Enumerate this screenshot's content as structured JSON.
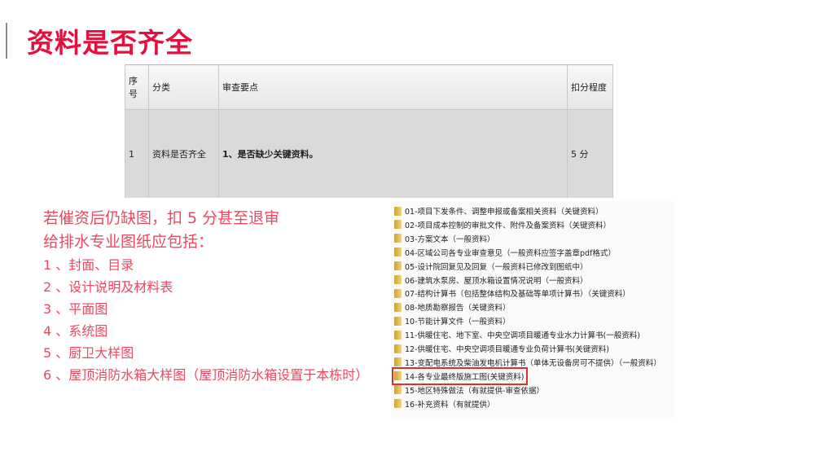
{
  "title": "资料是否齐全",
  "table": {
    "headers": [
      "序号",
      "分类",
      "审查要点",
      "扣分程度"
    ],
    "rows": [
      {
        "no": "1",
        "category": "资料是否齐全",
        "point": "1、是否缺少关键资料。",
        "deduction": "5 分"
      }
    ]
  },
  "notes": [
    "若催资后仍缺图，扣 5 分甚至退审",
    "给排水专业图纸应包括：",
    "1 、封面、目录",
    "2 、设计说明及材料表",
    "3 、平面图",
    "4 、系统图",
    "5 、厨卫大样图",
    "6 、屋顶消防水箱大样图（屋顶消防水箱设置于本栋时）"
  ],
  "files": [
    "01-项目下发条件、调整申报或备案相关资料（关键资料）",
    "02-项目成本控制的审批文件、附件及备案资料（关键资料）",
    "03-方案文本（一般资料）",
    "04-区域公司各专业审查意见（一般资料应签字盖章pdf格式）",
    "05-设计院回复见及回复（一般资料已修改到图纸中）",
    "06-建筑水泵房、屋顶水箱设置情况说明（一般资料）",
    "07-结构计算书（包括整体结构及基础等单项计算书）（关键资料）",
    "08-地质勘察报告（关键资料）",
    "10-节能计算文件（一般资料）",
    "11-供暖住宅、地下室、中央空调项目暖通专业水力计算书(一般资料)",
    "12-供暖住宅、中央空调项目暖通专业负荷计算书(关键资料)",
    "13-变配电系统及柴油发电机计算书（单体无设备房可不提供）（一般资料）",
    "14-各专业最终版施工图(关键资料)",
    "15-地区特殊做法（有就提供-审查依据）",
    "16-补充资料（有就提供）"
  ],
  "highlighted_index": 12
}
